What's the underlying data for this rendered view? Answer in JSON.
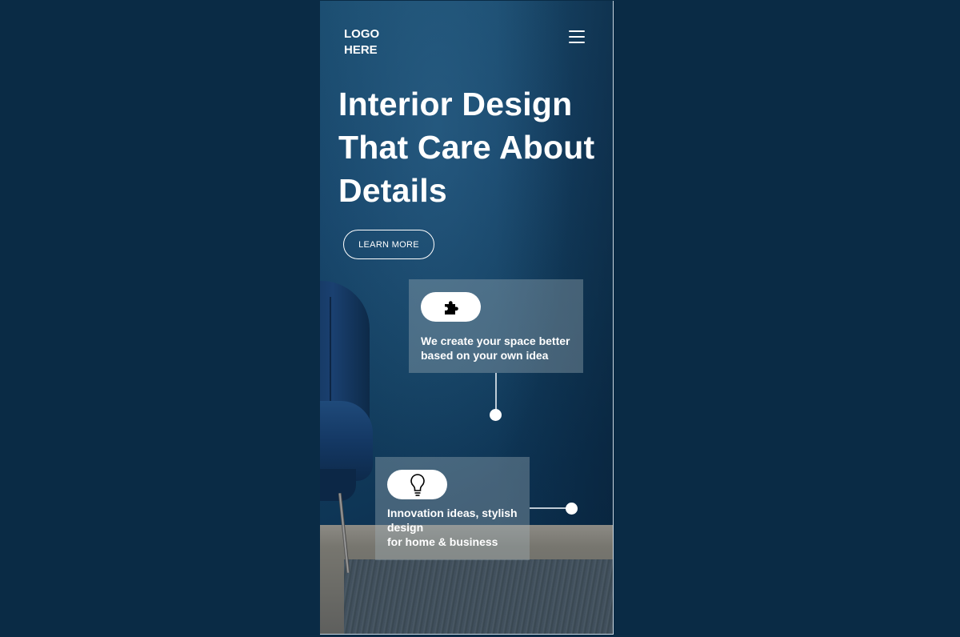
{
  "header": {
    "logo_text": "LOGO HERE",
    "menu_icon": "hamburger-menu-icon"
  },
  "hero": {
    "title": "Interior Design That Care About Details",
    "cta_label": "LEARN MORE"
  },
  "features": [
    {
      "icon": "puzzle-piece-icon",
      "text": "We create your space better based on your own idea"
    },
    {
      "icon": "lightbulb-icon",
      "text": "Innovation ideas, stylish design\nfor home & business"
    }
  ],
  "colors": {
    "page_background": "#0a2b45",
    "hero_wall": "#17456a",
    "text": "#ffffff"
  }
}
